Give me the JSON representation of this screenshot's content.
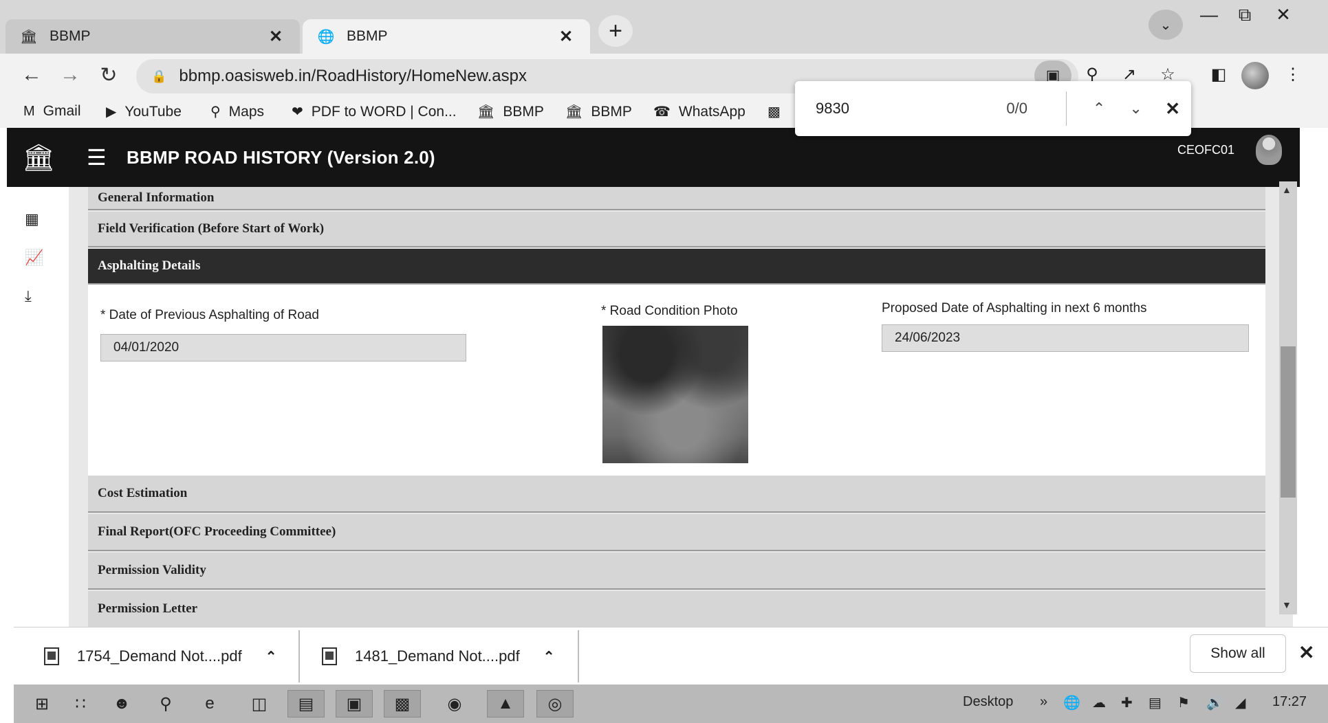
{
  "tabs": [
    {
      "title": "BBMP",
      "favicon": "bbmp-logo-icon",
      "active": false
    },
    {
      "title": "BBMP",
      "favicon": "globe-icon",
      "active": true
    }
  ],
  "address_bar": {
    "url": "bbmp.oasisweb.in/RoadHistory/HomeNew.aspx"
  },
  "bookmarks": [
    {
      "label": "Gmail",
      "icon": "gmail-icon"
    },
    {
      "label": "YouTube",
      "icon": "youtube-icon"
    },
    {
      "label": "Maps",
      "icon": "maps-icon"
    },
    {
      "label": "PDF to WORD | Con...",
      "icon": "pdf-convert-icon"
    },
    {
      "label": "BBMP",
      "icon": "bbmp-logo-icon"
    },
    {
      "label": "BBMP",
      "icon": "bbmp-logo-icon"
    },
    {
      "label": "WhatsApp",
      "icon": "whatsapp-icon"
    }
  ],
  "find_bar": {
    "query": "9830",
    "count": "0/0"
  },
  "app": {
    "title": "BBMP ROAD HISTORY (Version 2.0)",
    "username": "CEOFC01"
  },
  "sections": [
    {
      "label": "General Information",
      "active": false
    },
    {
      "label": "Field Verification (Before Start of Work)",
      "active": false
    },
    {
      "label": "Asphalting Details",
      "active": true
    },
    {
      "label": "Cost Estimation",
      "active": false
    },
    {
      "label": "Final Report(OFC Proceeding Committee)",
      "active": false
    },
    {
      "label": "Permission Validity",
      "active": false
    },
    {
      "label": "Permission Letter",
      "active": false
    }
  ],
  "asphalting": {
    "prev_date_label": "* Date of Previous Asphalting of Road",
    "prev_date_value": "04/01/2020",
    "photo_label": "* Road Condition Photo",
    "proposed_label": "Proposed Date of Asphalting in next 6 months",
    "proposed_value": "24/06/2023"
  },
  "downloads": {
    "items": [
      "1754_Demand Not....pdf",
      "1481_Demand Not....pdf"
    ],
    "show_all": "Show all"
  },
  "taskbar": {
    "desktop_label": "Desktop",
    "clock": "17:27"
  },
  "colors": {
    "app_header_bg": "#141414",
    "active_section_bg": "#2c2c2c",
    "section_bg": "#d6d6d6"
  }
}
